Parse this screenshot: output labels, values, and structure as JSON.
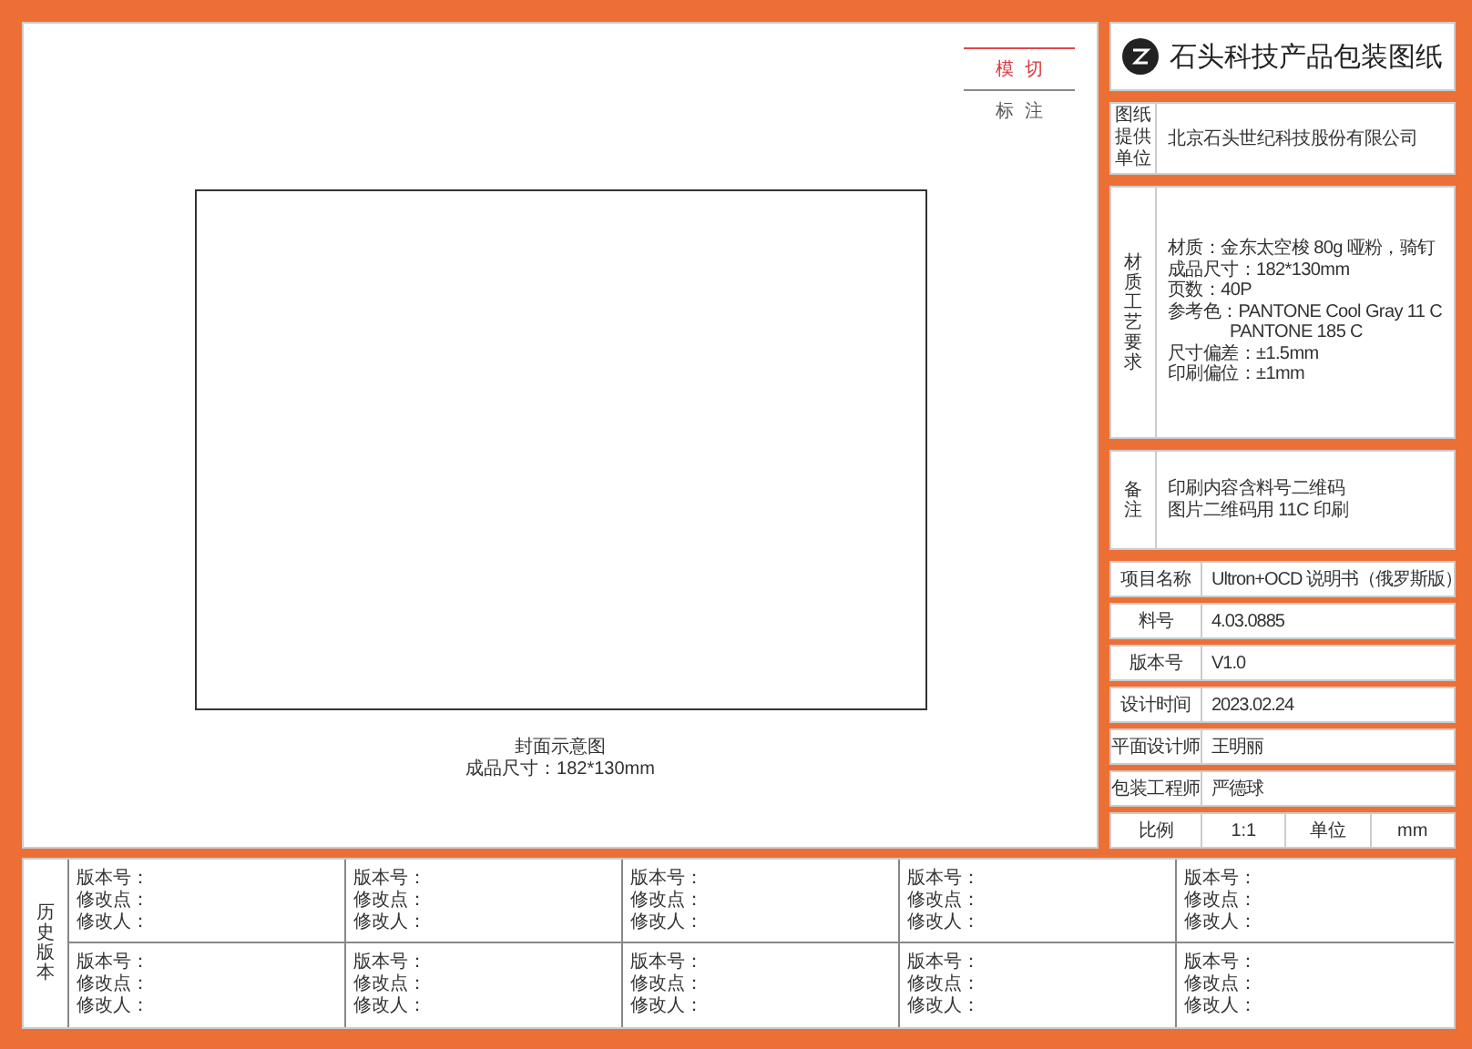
{
  "legend": [
    {
      "label": "模切",
      "kind": "die-cut"
    },
    {
      "label": "标注",
      "kind": "annotation"
    }
  ],
  "preview": {
    "caption": "封面示意图",
    "size": "成品尺寸：182*130mm"
  },
  "title": {
    "text": "石头科技产品包装图纸"
  },
  "provider": {
    "label": "图纸提供单位",
    "value": "北京石头世纪科技股份有限公司"
  },
  "materials": {
    "label": "材质工艺要求",
    "lines": [
      {
        "text": "材质：金东太空梭 80g 哑粉，骑钉",
        "indent": false
      },
      {
        "text": "成品尺寸：182*130mm",
        "indent": false
      },
      {
        "text": "页数：40P",
        "indent": false
      },
      {
        "text": "参考色：PANTONE Cool Gray 11 C",
        "indent": false
      },
      {
        "text": "PANTONE 185 C",
        "indent": true
      },
      {
        "text": "尺寸偏差：±1.5mm",
        "indent": false
      },
      {
        "text": "印刷偏位：±1mm",
        "indent": false
      }
    ]
  },
  "notes": {
    "label": "备注",
    "lines": [
      "印刷内容含料号二维码",
      "图片二维码用 11C 印刷"
    ]
  },
  "info_rows": [
    {
      "label": "项目名称",
      "value": "Ultron+OCD 说明书（俄罗斯版）"
    },
    {
      "label": "料号",
      "value": "4.03.0885"
    },
    {
      "label": "版本号",
      "value": "V1.0"
    },
    {
      "label": "设计时间",
      "value": "2023.02.24"
    },
    {
      "label": "平面设计师",
      "value": "王明丽"
    },
    {
      "label": "包装工程师",
      "value": "严德球"
    }
  ],
  "scale_row": {
    "label": "比例",
    "value": "1:1",
    "unit_label": "单位",
    "unit": "mm"
  },
  "history": {
    "label": "历史版本",
    "entries": [
      [
        "版本号：",
        "修改点：",
        "修改人："
      ],
      [
        "版本号：",
        "修改点：",
        "修改人："
      ],
      [
        "版本号：",
        "修改点：",
        "修改人："
      ],
      [
        "版本号：",
        "修改点：",
        "修改人："
      ],
      [
        "版本号：",
        "修改点：",
        "修改人："
      ],
      [
        "版本号：",
        "修改点：",
        "修改人："
      ],
      [
        "版本号：",
        "修改点：",
        "修改人："
      ],
      [
        "版本号：",
        "修改点：",
        "修改人："
      ],
      [
        "版本号：",
        "修改点：",
        "修改人："
      ],
      [
        "版本号：",
        "修改点：",
        "修改人："
      ]
    ]
  }
}
